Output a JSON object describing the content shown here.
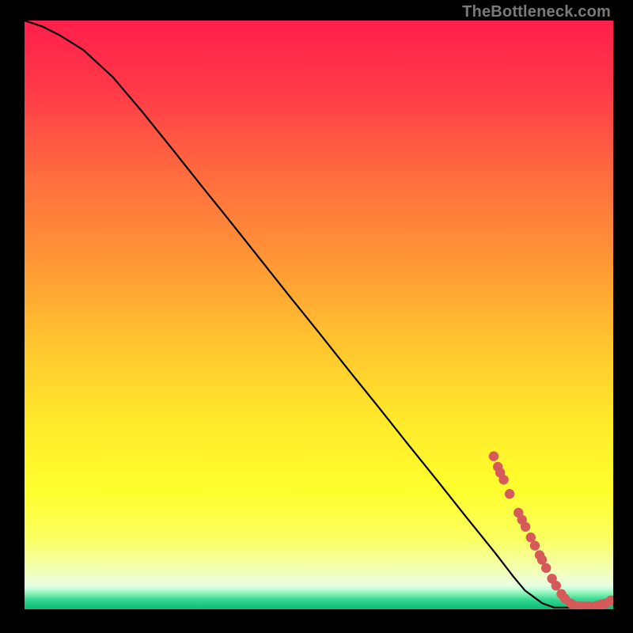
{
  "watermark": "TheBottleneck.com",
  "chart_data": {
    "type": "line",
    "title": "",
    "xlabel": "",
    "ylabel": "",
    "xlim": [
      0,
      100
    ],
    "ylim": [
      0,
      100
    ],
    "series": [
      {
        "name": "bottleneck-curve",
        "x": [
          0,
          3,
          6,
          10,
          15,
          20,
          25,
          30,
          35,
          40,
          45,
          50,
          55,
          60,
          65,
          70,
          75,
          80,
          83,
          85,
          88,
          90,
          92,
          94,
          96,
          98,
          100
        ],
        "y": [
          100,
          99,
          97.5,
          95,
          90.4,
          84.5,
          78.3,
          72,
          65.8,
          59.5,
          53.2,
          47,
          40.7,
          34.5,
          28.2,
          22,
          15.7,
          9.5,
          5.6,
          3.2,
          1.0,
          0.3,
          0.3,
          0.3,
          0.5,
          0.8,
          1.3
        ]
      }
    ],
    "markers": {
      "name": "highlight-dots",
      "color": "#d65a5a",
      "points": [
        {
          "x": 79.7,
          "y": 26.0
        },
        {
          "x": 80.4,
          "y": 24.2
        },
        {
          "x": 80.8,
          "y": 23.2
        },
        {
          "x": 81.4,
          "y": 22.0
        },
        {
          "x": 82.4,
          "y": 19.6
        },
        {
          "x": 83.9,
          "y": 16.4
        },
        {
          "x": 84.5,
          "y": 15.2
        },
        {
          "x": 85.1,
          "y": 14.0
        },
        {
          "x": 86.0,
          "y": 12.2
        },
        {
          "x": 86.7,
          "y": 10.8
        },
        {
          "x": 87.5,
          "y": 9.2
        },
        {
          "x": 87.9,
          "y": 8.4
        },
        {
          "x": 88.6,
          "y": 7.0
        },
        {
          "x": 89.6,
          "y": 5.2
        },
        {
          "x": 90.3,
          "y": 4.0
        },
        {
          "x": 91.2,
          "y": 2.6
        },
        {
          "x": 91.8,
          "y": 1.8
        },
        {
          "x": 92.8,
          "y": 1.0
        },
        {
          "x": 93.4,
          "y": 0.6
        },
        {
          "x": 93.9,
          "y": 0.5
        },
        {
          "x": 94.5,
          "y": 0.5
        },
        {
          "x": 95.2,
          "y": 0.5
        },
        {
          "x": 96.0,
          "y": 0.5
        },
        {
          "x": 97.2,
          "y": 0.6
        },
        {
          "x": 98.0,
          "y": 0.8
        },
        {
          "x": 98.7,
          "y": 1.0
        },
        {
          "x": 99.6,
          "y": 1.5
        }
      ]
    },
    "gradient_stops": [
      {
        "pos": 0.0,
        "color": "#ff1f4b"
      },
      {
        "pos": 0.12,
        "color": "#ff3a49"
      },
      {
        "pos": 0.26,
        "color": "#ff6b3f"
      },
      {
        "pos": 0.4,
        "color": "#ff9436"
      },
      {
        "pos": 0.54,
        "color": "#ffc22f"
      },
      {
        "pos": 0.68,
        "color": "#ffe92b"
      },
      {
        "pos": 0.8,
        "color": "#ffff2d"
      },
      {
        "pos": 0.88,
        "color": "#faff60"
      },
      {
        "pos": 0.93,
        "color": "#f4ffb0"
      },
      {
        "pos": 0.958,
        "color": "#eaffe0"
      },
      {
        "pos": 0.965,
        "color": "#c8ffdc"
      },
      {
        "pos": 0.973,
        "color": "#8af2b7"
      },
      {
        "pos": 0.983,
        "color": "#39d994"
      },
      {
        "pos": 0.993,
        "color": "#17c77f"
      },
      {
        "pos": 1.0,
        "color": "#0dbd78"
      }
    ]
  }
}
